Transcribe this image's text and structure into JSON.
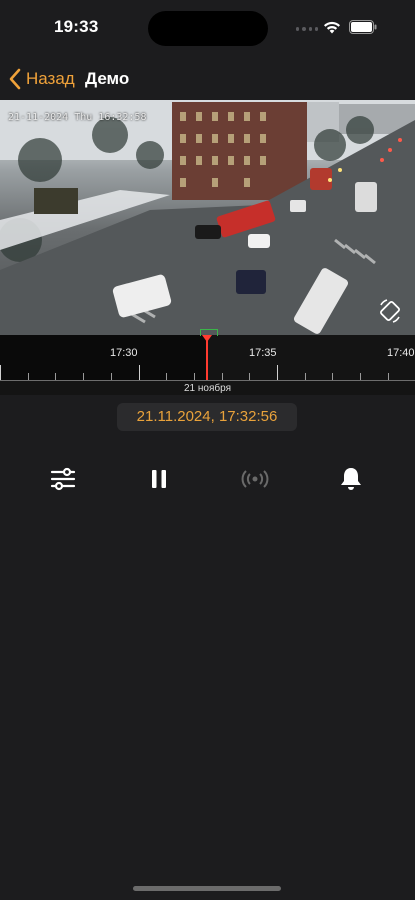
{
  "status_bar": {
    "time": "19:33"
  },
  "nav": {
    "back_label": "Назад",
    "title": "Демо"
  },
  "video": {
    "osd_text": "21-11-2024 Thu 16:32:58"
  },
  "timeline": {
    "labels": [
      "17:30",
      "17:35",
      "17:40"
    ],
    "date_label": "21 ноября"
  },
  "date_display": "21.11.2024, 17:32:56",
  "controls": {
    "settings_icon": "sliders-icon",
    "pause_icon": "pause-icon",
    "live_icon": "broadcast-icon",
    "notify_icon": "bell-icon"
  },
  "colors": {
    "accent": "#f0a23a",
    "cursor": "#ff3b30",
    "background": "#1c1c1e"
  }
}
